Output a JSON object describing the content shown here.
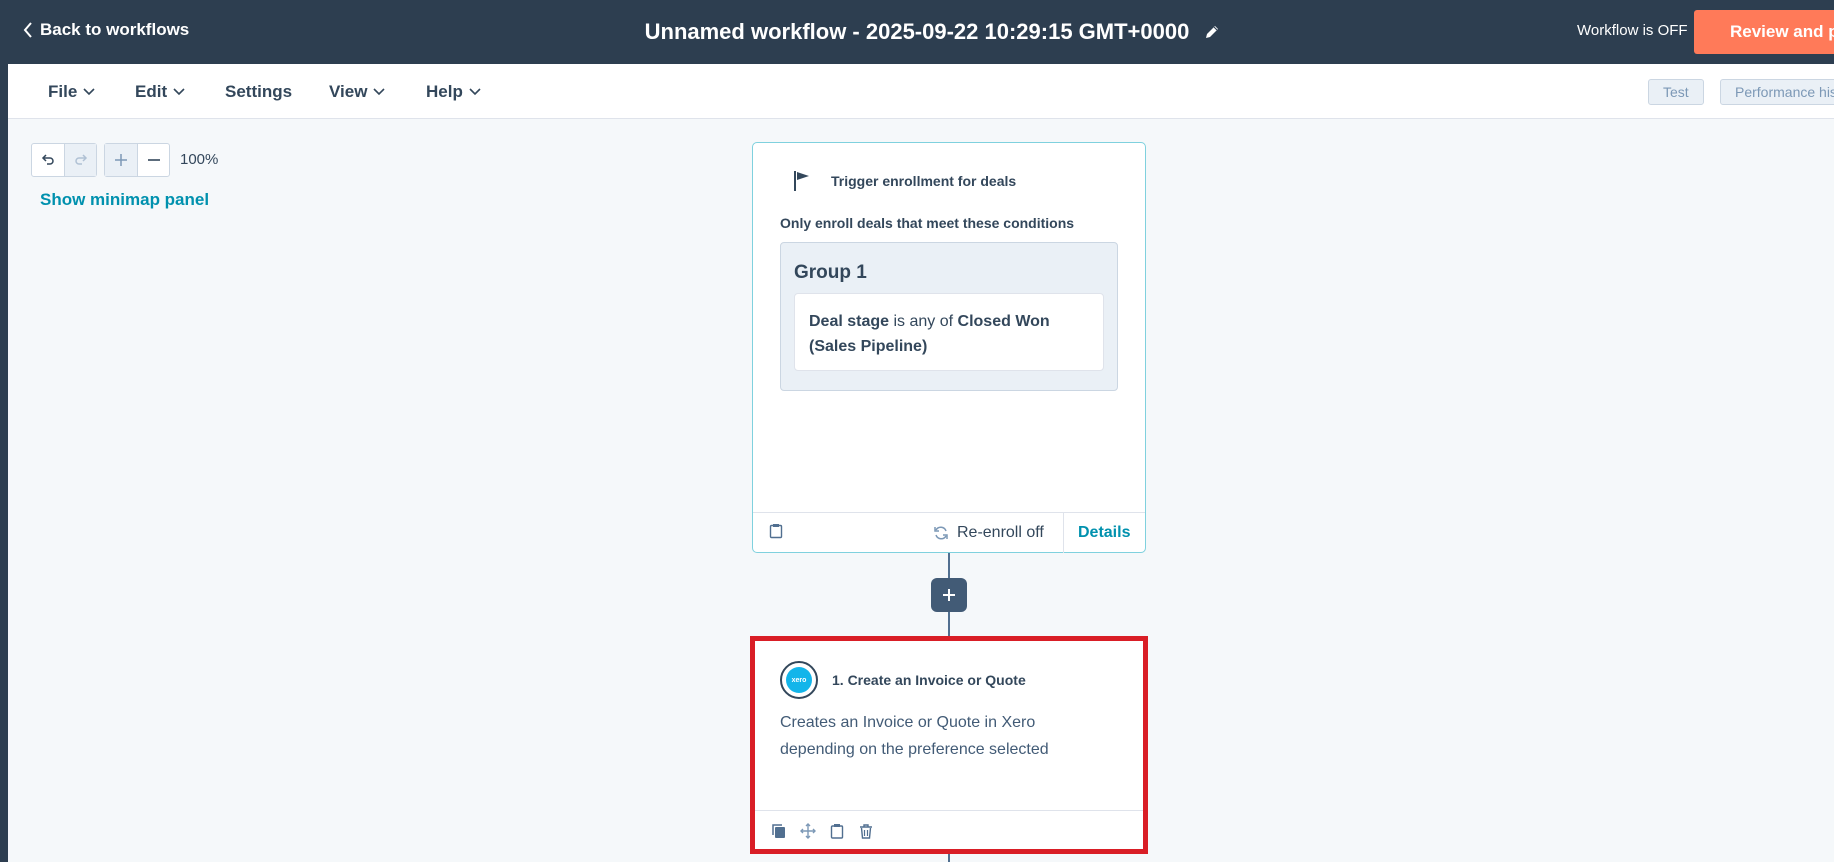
{
  "topbar": {
    "back_label": "Back to workflows",
    "workflow_title": "Unnamed workflow - 2025-09-22 10:29:15 GMT+0000",
    "status": "Workflow is OFF",
    "review_label": "Review and pu"
  },
  "menubar": {
    "items": [
      {
        "label": "File",
        "has_dropdown": true
      },
      {
        "label": "Edit",
        "has_dropdown": true
      },
      {
        "label": "Settings",
        "has_dropdown": false
      },
      {
        "label": "View",
        "has_dropdown": true
      },
      {
        "label": "Help",
        "has_dropdown": true
      }
    ],
    "test_label": "Test",
    "performance_label": "Performance his"
  },
  "canvas": {
    "zoom": "100%",
    "minimap_label": "Show minimap panel"
  },
  "trigger": {
    "title": "Trigger enrollment for deals",
    "subtitle": "Only enroll deals that meet these conditions",
    "group_title": "Group 1",
    "condition": {
      "property": "Deal stage",
      "operator": " is any of ",
      "value": "Closed Won (Sales Pipeline)"
    },
    "reenroll_label": "Re-enroll off",
    "details_label": "Details"
  },
  "action": {
    "title": "1. Create an Invoice or Quote",
    "app_logo": "xero",
    "description": "Creates an Invoice or Quote in Xero depending on the preference selected"
  },
  "colors": {
    "topbar_bg": "#2d3e50",
    "accent_orange": "#ff7a59",
    "link_teal": "#0091ae",
    "highlight_red": "#d91e26",
    "xero_blue": "#13b5ea"
  },
  "icons": [
    "chevron-left-icon",
    "pencil-icon",
    "chevron-down-icon",
    "undo-icon",
    "redo-icon",
    "plus-icon",
    "minus-icon",
    "flag-icon",
    "clipboard-icon",
    "refresh-icon",
    "xero-logo-icon",
    "copy-icon",
    "move-icon",
    "trash-icon"
  ]
}
